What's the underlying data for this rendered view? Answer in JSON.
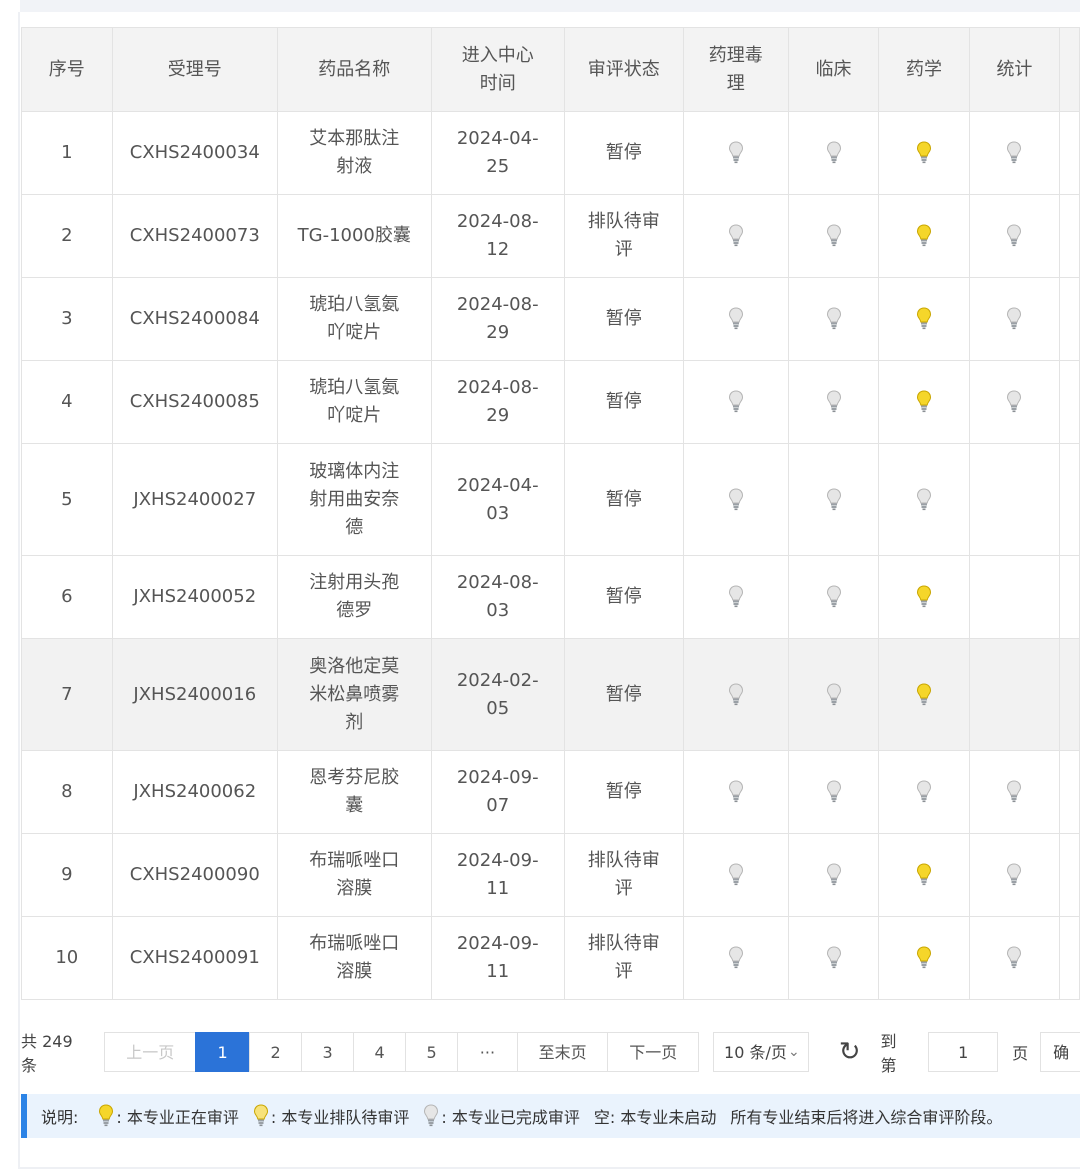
{
  "columns": [
    "序号",
    "受理号",
    "药品名称",
    "进入中心\n时间",
    "审评状态",
    "药理毒\n理",
    "临床",
    "药学",
    "统计"
  ],
  "rows": [
    {
      "no": "1",
      "id": "CXHS2400034",
      "name": "艾本那肽注\n射液",
      "date": "2024-04-\n25",
      "status": "暂停",
      "bulbs": [
        "done",
        "done",
        "active",
        "done"
      ]
    },
    {
      "no": "2",
      "id": "CXHS2400073",
      "name": "TG-1000胶囊",
      "date": "2024-08-\n12",
      "status": "排队待审\n评",
      "bulbs": [
        "done",
        "done",
        "active",
        "done"
      ]
    },
    {
      "no": "3",
      "id": "CXHS2400084",
      "name": "琥珀八氢氨\n吖啶片",
      "date": "2024-08-\n29",
      "status": "暂停",
      "bulbs": [
        "done",
        "done",
        "active",
        "done"
      ]
    },
    {
      "no": "4",
      "id": "CXHS2400085",
      "name": "琥珀八氢氨\n吖啶片",
      "date": "2024-08-\n29",
      "status": "暂停",
      "bulbs": [
        "done",
        "done",
        "active",
        "done"
      ]
    },
    {
      "no": "5",
      "id": "JXHS2400027",
      "name": "玻璃体内注\n射用曲安奈\n德",
      "date": "2024-04-\n03",
      "status": "暂停",
      "bulbs": [
        "done",
        "done",
        "done",
        "none"
      ]
    },
    {
      "no": "6",
      "id": "JXHS2400052",
      "name": "注射用头孢\n德罗",
      "date": "2024-08-\n03",
      "status": "暂停",
      "bulbs": [
        "done",
        "done",
        "active",
        "none"
      ]
    },
    {
      "no": "7",
      "id": "JXHS2400016",
      "name": "奥洛他定莫\n米松鼻喷雾\n剂",
      "date": "2024-02-\n05",
      "status": "暂停",
      "bulbs": [
        "done",
        "done",
        "active",
        "none"
      ],
      "highlight": true
    },
    {
      "no": "8",
      "id": "JXHS2400062",
      "name": "恩考芬尼胶\n囊",
      "date": "2024-09-\n07",
      "status": "暂停",
      "bulbs": [
        "done",
        "done",
        "done",
        "done"
      ]
    },
    {
      "no": "9",
      "id": "CXHS2400090",
      "name": "布瑞哌唑口\n溶膜",
      "date": "2024-09-\n11",
      "status": "排队待审\n评",
      "bulbs": [
        "done",
        "done",
        "active",
        "done"
      ]
    },
    {
      "no": "10",
      "id": "CXHS2400091",
      "name": "布瑞哌唑口\n溶膜",
      "date": "2024-09-\n11",
      "status": "排队待审\n评",
      "bulbs": [
        "done",
        "done",
        "active",
        "done"
      ]
    }
  ],
  "pager": {
    "total": "共 249 条",
    "prev": "上一页",
    "pages": [
      "1",
      "2",
      "3",
      "4",
      "5"
    ],
    "ellipsis": "···",
    "last": "至末页",
    "next": "下一页",
    "page_size": "10 条/页",
    "goto_label": "到第",
    "goto_value": "1",
    "page_suffix": "页",
    "confirm": "确定"
  },
  "legend": {
    "label": "说明:",
    "active": ": 本专业正在审评",
    "queued": ": 本专业排队待审评",
    "done": ": 本专业已完成审评",
    "empty": "空: 本专业未启动",
    "note": "所有专业结束后将进入综合审评阶段。"
  },
  "colors": {
    "bulb_active": "#f5d62a",
    "bulb_done": "#e6e6e6",
    "accent": "#2b73d8",
    "legend_bg": "#eaf3fd"
  }
}
